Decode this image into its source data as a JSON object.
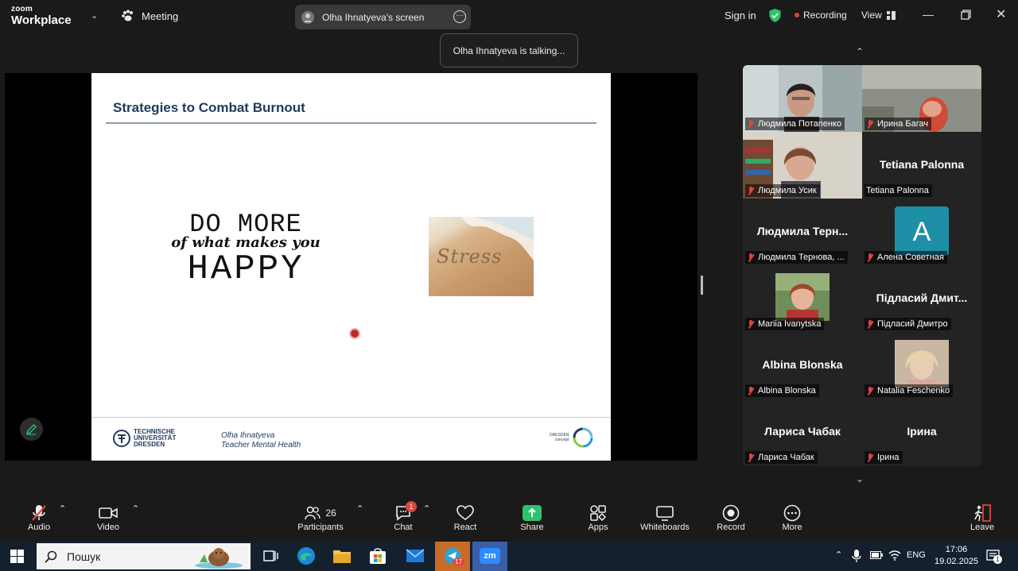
{
  "window": {
    "logo_line1": "zoom",
    "logo_line2": "Workplace",
    "meeting_label": "Meeting",
    "screen_owner": "Olha Ihnatyeva's screen",
    "sign_in": "Sign in",
    "recording": "Recording",
    "view": "View",
    "talking": "Olha Ihnatyeva is talking..."
  },
  "slide": {
    "title": "Strategies to Combat Burnout",
    "graphic_line1": "DO MORE",
    "graphic_line2": "of what makes you",
    "graphic_line3": "HAPPY",
    "sand_word": "Stress",
    "university": [
      "TECHNISCHE",
      "UNIVERSITÄT",
      "DRESDEN"
    ],
    "author": "Olha Ihnatyeva",
    "subtitle": "Teacher Mental Health",
    "partner": [
      "DRESDEN",
      "concept"
    ]
  },
  "participants": [
    {
      "label": "Людмила Потапенко",
      "video": true
    },
    {
      "label": "Ирина Багач",
      "video": true
    },
    {
      "label": "Людмила Усик",
      "video": true
    },
    {
      "label": "Tetiana Palonna",
      "big": "Tetiana Palonna"
    },
    {
      "label": "Людмила Тернова, ...",
      "big": "Людмила  Терн..."
    },
    {
      "label": "Алена Советная",
      "avatar": "A"
    },
    {
      "label": "Mariia Ivanytska",
      "video": true
    },
    {
      "label": "Підласий Дмитро",
      "big": "Підласий  Дмит..."
    },
    {
      "label": "Albina Blonska",
      "big": "Albina Blonska"
    },
    {
      "label": "Natalia Feschenko",
      "video": true
    },
    {
      "label": "Лариса Чабак",
      "big": "Лариса Чабак"
    },
    {
      "label": "Ірина",
      "big": "Ірина"
    }
  ],
  "toolbar": {
    "audio": "Audio",
    "video": "Video",
    "participants": "Participants",
    "participants_count": "26",
    "chat": "Chat",
    "chat_badge": "1",
    "react": "React",
    "share": "Share",
    "apps": "Apps",
    "whiteboards": "Whiteboards",
    "record": "Record",
    "more": "More",
    "leave": "Leave"
  },
  "taskbar": {
    "search_placeholder": "Пошук",
    "telegram_badge": "17",
    "zoom_label": "zm",
    "language": "ENG",
    "time": "17:06",
    "date": "19.02.2025",
    "notifications": "1"
  },
  "colors": {
    "accent_green": "#2dc36a",
    "record_red": "#e0443e",
    "avatar_teal": "#1d8fa6",
    "slide_title": "#1f3a5f"
  }
}
